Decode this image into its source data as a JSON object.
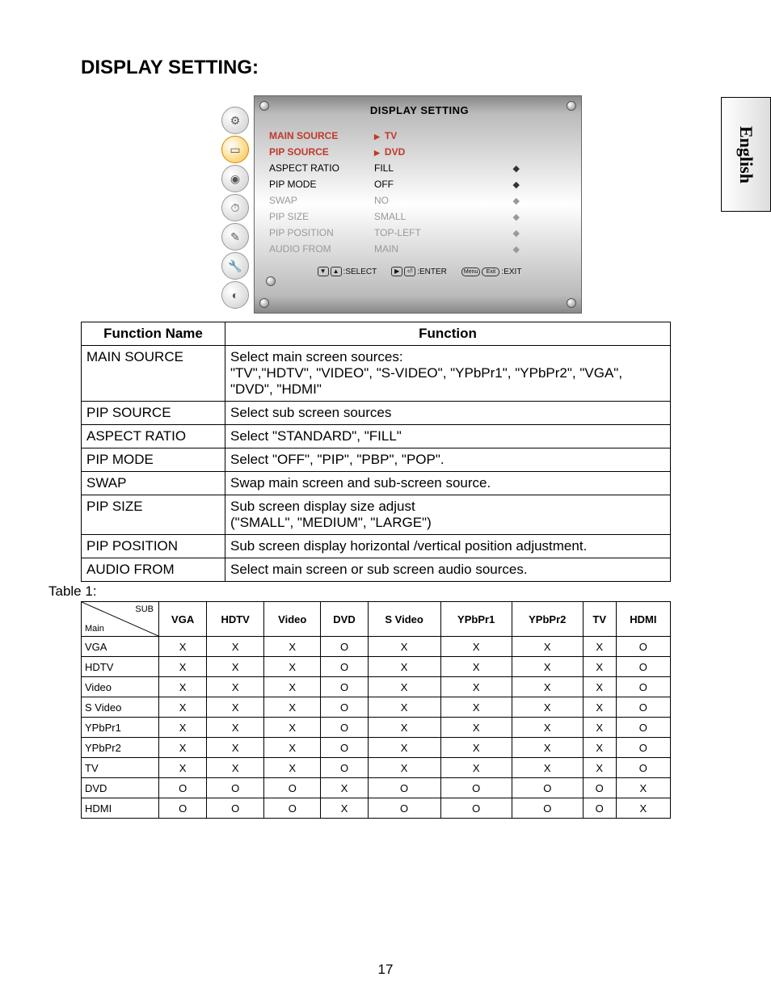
{
  "sideTab": "English",
  "pageTitle": "DISPLAY SETTING:",
  "osd": {
    "title": "DISPLAY SETTING",
    "rows": [
      {
        "label": "MAIN SOURCE",
        "value": "TV",
        "hl": true,
        "arrow": true,
        "ind": ""
      },
      {
        "label": "PIP SOURCE",
        "value": "DVD",
        "hl": true,
        "arrow": true,
        "ind": ""
      },
      {
        "label": "ASPECT RATIO",
        "value": "FILL",
        "hl": false,
        "ind": "◆"
      },
      {
        "label": "PIP MODE",
        "value": "OFF",
        "hl": false,
        "ind": "◆"
      },
      {
        "label": "SWAP",
        "value": "NO",
        "dim": true,
        "ind": "◆"
      },
      {
        "label": "PIP SIZE",
        "value": "SMALL",
        "dim": true,
        "ind": "◆"
      },
      {
        "label": "PIP POSITION",
        "value": "TOP-LEFT",
        "dim": true,
        "ind": "◆"
      },
      {
        "label": "AUDIO FROM",
        "value": "MAIN",
        "dim": true,
        "ind": "◆"
      }
    ],
    "footer": {
      "select": ":SELECT",
      "enter": ":ENTER",
      "exit": ":EXIT"
    },
    "footerKeys": {
      "menu": "Menu",
      "exit": "Exit"
    },
    "icons": [
      "star",
      "screen",
      "dial",
      "clock",
      "pencil",
      "wrench",
      "logo"
    ]
  },
  "funcTable": {
    "headers": [
      "Function Name",
      "Function"
    ],
    "rows": [
      {
        "name": "MAIN SOURCE",
        "desc": "Select main screen sources:\n\"TV\",\"HDTV\", \"VIDEO\", \"S-VIDEO\", \"YPbPr1\", \"YPbPr2\", \"VGA\", \"DVD\", \"HDMI\""
      },
      {
        "name": "PIP SOURCE",
        "desc": "Select sub screen sources"
      },
      {
        "name": "ASPECT RATIO",
        "desc": "Select \"STANDARD\", \"FILL\""
      },
      {
        "name": "PIP MODE",
        "desc": "Select \"OFF\", \"PIP\", \"PBP\", \"POP\"."
      },
      {
        "name": "SWAP",
        "desc": "Swap main screen and sub-screen source."
      },
      {
        "name": "PIP SIZE",
        "desc": "Sub screen display size adjust\n(\"SMALL\", \"MEDIUM\", \"LARGE\")"
      },
      {
        "name": "PIP POSITION",
        "desc": "Sub screen display horizontal /vertical position adjustment."
      },
      {
        "name": "AUDIO FROM",
        "desc": "Select main screen or sub screen audio sources."
      }
    ]
  },
  "tableLabel": "Table 1:",
  "matrix": {
    "diag": {
      "sub": "SUB",
      "main": "Main"
    },
    "cols": [
      "VGA",
      "HDTV",
      "Video",
      "DVD",
      "S Video",
      "YPbPr1",
      "YPbPr2",
      "TV",
      "HDMI"
    ],
    "rows": [
      {
        "name": "VGA",
        "cells": [
          "X",
          "X",
          "X",
          "O",
          "X",
          "X",
          "X",
          "X",
          "O"
        ]
      },
      {
        "name": "HDTV",
        "cells": [
          "X",
          "X",
          "X",
          "O",
          "X",
          "X",
          "X",
          "X",
          "O"
        ]
      },
      {
        "name": "Video",
        "cells": [
          "X",
          "X",
          "X",
          "O",
          "X",
          "X",
          "X",
          "X",
          "O"
        ]
      },
      {
        "name": "S Video",
        "cells": [
          "X",
          "X",
          "X",
          "O",
          "X",
          "X",
          "X",
          "X",
          "O"
        ]
      },
      {
        "name": "YPbPr1",
        "cells": [
          "X",
          "X",
          "X",
          "O",
          "X",
          "X",
          "X",
          "X",
          "O"
        ]
      },
      {
        "name": "YPbPr2",
        "cells": [
          "X",
          "X",
          "X",
          "O",
          "X",
          "X",
          "X",
          "X",
          "O"
        ]
      },
      {
        "name": "TV",
        "cells": [
          "X",
          "X",
          "X",
          "O",
          "X",
          "X",
          "X",
          "X",
          "O"
        ]
      },
      {
        "name": "DVD",
        "cells": [
          "O",
          "O",
          "O",
          "X",
          "O",
          "O",
          "O",
          "O",
          "X"
        ]
      },
      {
        "name": "HDMI",
        "cells": [
          "O",
          "O",
          "O",
          "X",
          "O",
          "O",
          "O",
          "O",
          "X"
        ]
      }
    ]
  },
  "pageNumber": "17"
}
